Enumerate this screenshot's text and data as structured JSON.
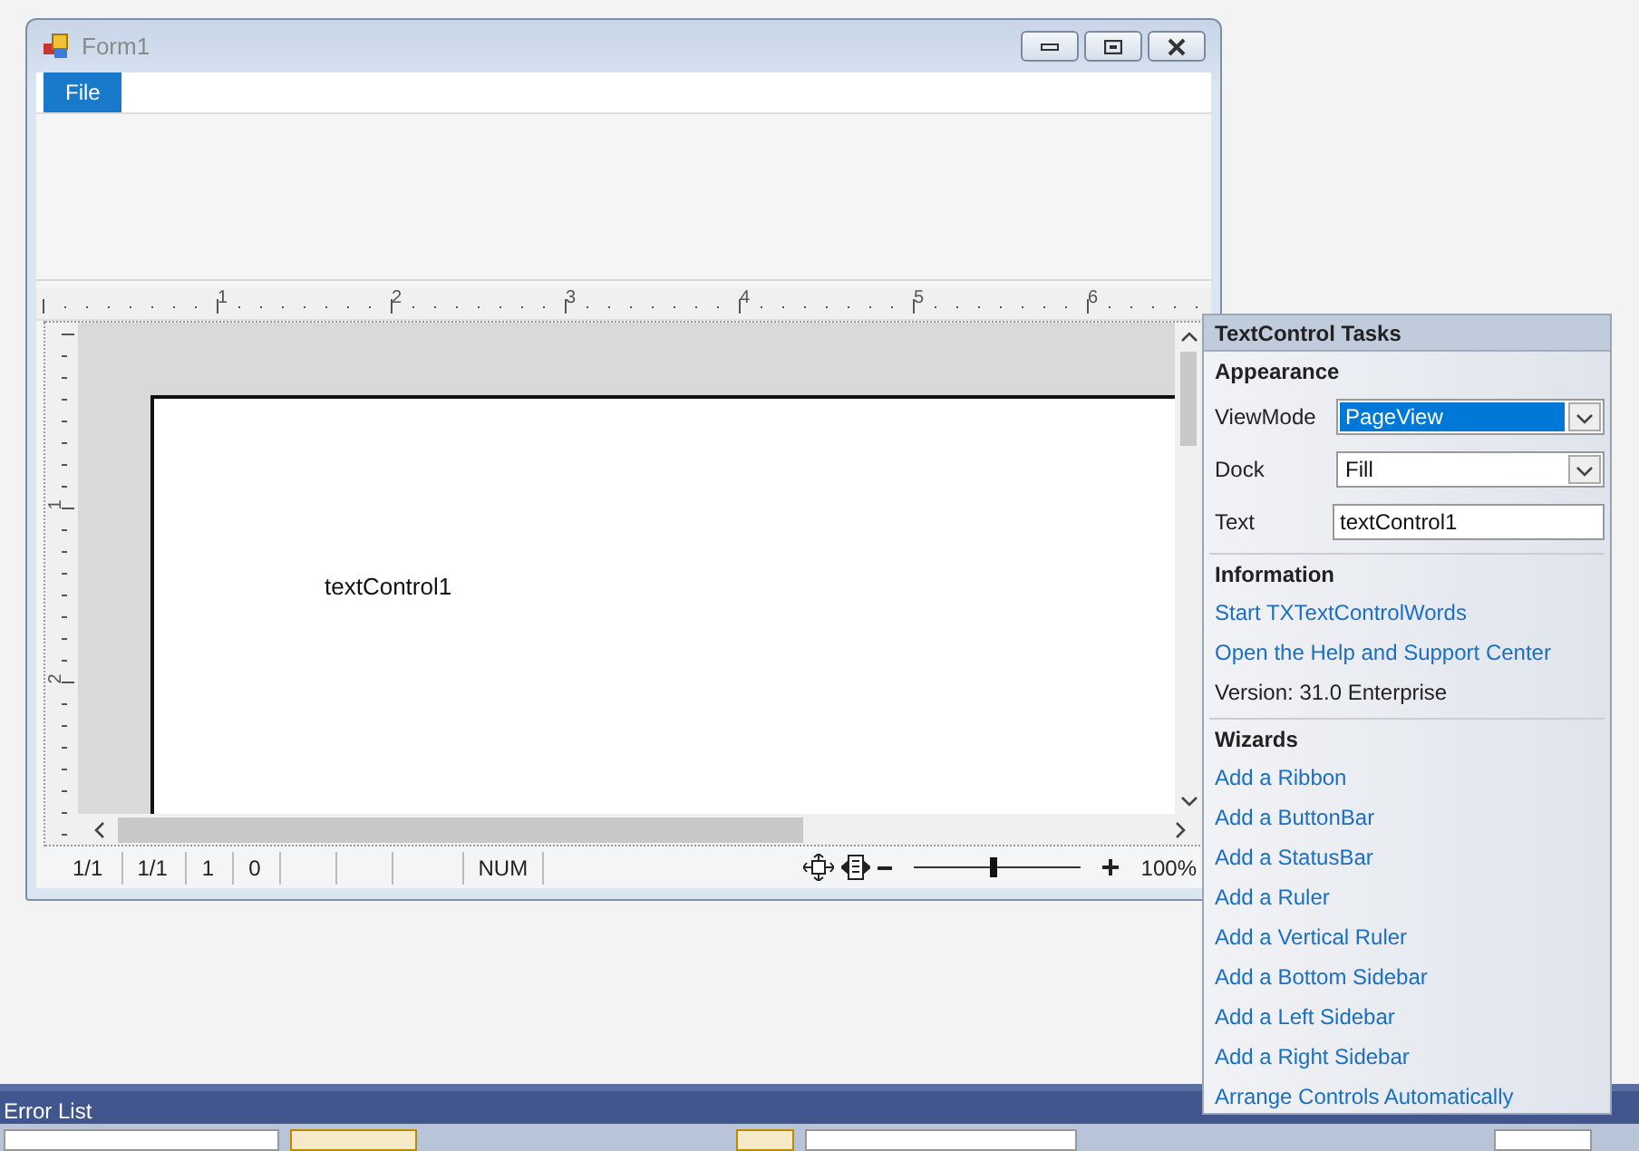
{
  "window": {
    "title": "Form1"
  },
  "menu": [
    {
      "label": "File",
      "selected": true
    }
  ],
  "ruler": {
    "labels": [
      "1",
      "2",
      "3",
      "4",
      "5",
      "6"
    ]
  },
  "vertical_ruler": {
    "labels": [
      "1",
      "2"
    ]
  },
  "document": {
    "text": "textControl1"
  },
  "status_bar": {
    "panels": [
      "1/1",
      "1/1",
      "1",
      "0"
    ],
    "num": "NUM",
    "zoom": "100%",
    "zoom_slider": {
      "level": 0.47
    }
  },
  "tasks_panel": {
    "title": "TextControl Tasks",
    "sections": [
      {
        "heading": "Appearance",
        "items": [
          {
            "kind": "dropdown",
            "label": "ViewMode",
            "value": "PageView",
            "highlighted": true
          },
          {
            "kind": "dropdown",
            "label": "Dock",
            "value": "Fill",
            "highlighted": false
          },
          {
            "kind": "textbox",
            "label": "Text",
            "value": "textControl1"
          }
        ]
      },
      {
        "heading": "Information",
        "items": [
          {
            "kind": "link",
            "text": "Start TXTextControlWords"
          },
          {
            "kind": "link",
            "text": "Open the Help and Support Center"
          },
          {
            "kind": "note",
            "text": "Version: 31.0 Enterprise"
          }
        ]
      },
      {
        "heading": "Wizards",
        "items": [
          {
            "kind": "link",
            "text": "Add a Ribbon"
          },
          {
            "kind": "link",
            "text": "Add a ButtonBar"
          },
          {
            "kind": "link",
            "text": "Add a StatusBar"
          },
          {
            "kind": "link",
            "text": "Add a Ruler"
          },
          {
            "kind": "link",
            "text": "Add a Vertical Ruler"
          },
          {
            "kind": "link",
            "text": "Add a Bottom Sidebar"
          },
          {
            "kind": "link",
            "text": "Add a Left Sidebar"
          },
          {
            "kind": "link",
            "text": "Add a Right Sidebar"
          },
          {
            "kind": "link",
            "text": "Arrange Controls Automatically"
          }
        ]
      }
    ]
  },
  "error_list": {
    "title": "Error List",
    "toggles": [
      {
        "on": true
      },
      {
        "on": true
      }
    ]
  }
}
